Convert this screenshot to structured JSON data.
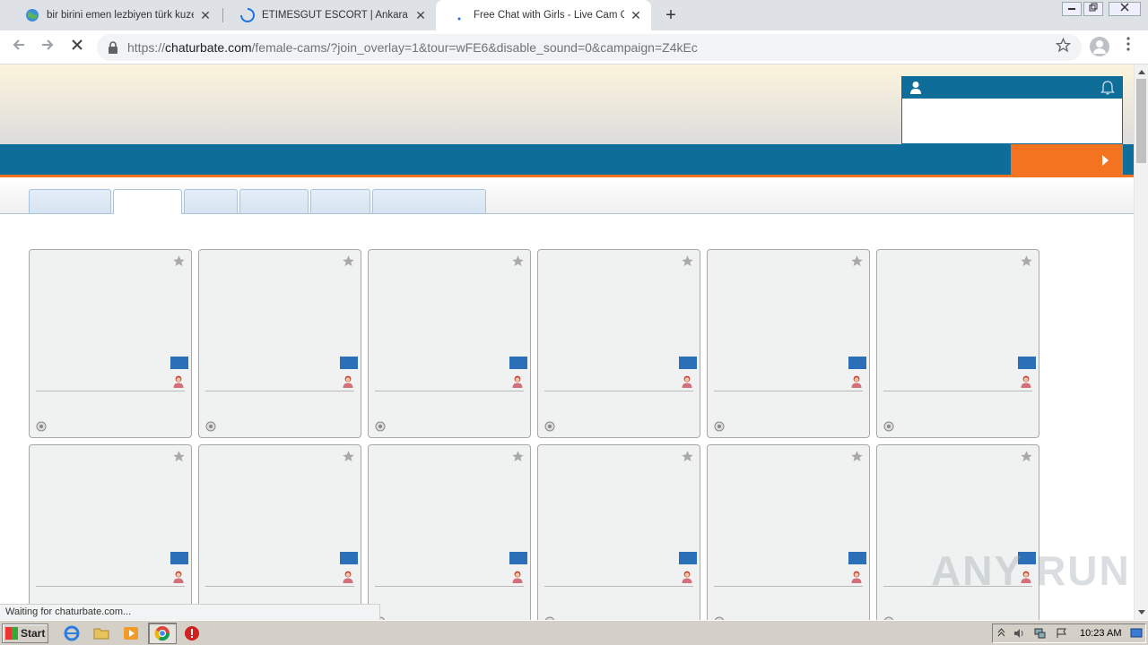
{
  "browser": {
    "tabs": [
      {
        "title": "bir birini emen lezbiyen türk kuzenler",
        "active": false
      },
      {
        "title": "ETİMESGUT ESCORT | Ankara escort",
        "active": false
      },
      {
        "title": "Free Chat with Girls - Live Cam Girls, ",
        "active": true
      }
    ],
    "new_tab_label": "+",
    "close_label": "✕",
    "url_scheme": "https://",
    "url_host": "chaturbate.com",
    "url_path": "/female-cams/?join_overlay=1&tour=wFE6&disable_sound=0&campaign=Z4kEc",
    "status_text": "Waiting for chaturbate.com..."
  },
  "page": {
    "accent_blue": "#0e6d99",
    "accent_orange": "#f47321",
    "subtab_count": 6,
    "card_rows": 2,
    "card_cols": 6
  },
  "watermark": "ANY RUN",
  "taskbar": {
    "start_label": "Start",
    "clock": "10:23 AM"
  }
}
